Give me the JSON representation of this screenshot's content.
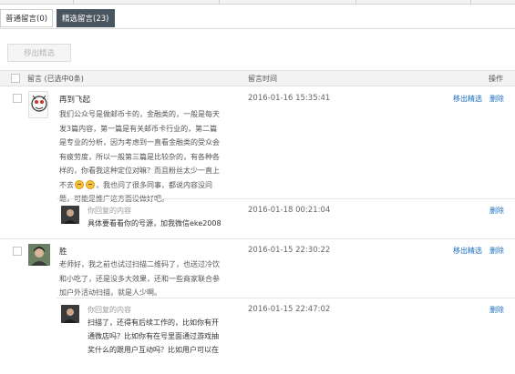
{
  "tabs": [
    {
      "label": "普通留言(0)"
    },
    {
      "label": "精选留言(23)"
    }
  ],
  "toolbar": {
    "move_label": "移出精选"
  },
  "table_header": {
    "message": "留言 (已选中0条)",
    "time": "留言时间",
    "action": "操作"
  },
  "comments": [
    {
      "nickname": "再到飞起",
      "lines": [
        "我们公众号是做邮币卡的，金融类的，一般是每天",
        "发3篇内容，第一篇是有关邮币卡行业的，第二篇",
        "是专业的分析，因为考虑到一直看金融类的受众会",
        "有疲劳度，所以一般第三篇是比较杂的，有各种各",
        "样的，你看我这种定位对嘛？而且粉丝太少一直上",
        "不去",
        "，我也问了很多同事，都说内容没问",
        "题，可能是推广这方面没做好吧。"
      ],
      "time": "2016-01-16 15:35:41",
      "action_primary": "移出精选",
      "action_delete": "删除",
      "reply": {
        "label": "你回复的内容",
        "lines": [
          "具体要看看你的号源，加我微信eke2008"
        ],
        "time": "2016-01-18 00:21:04",
        "action_delete": "删除"
      }
    },
    {
      "nickname": "胜",
      "lines": [
        "老师好，我之前也试过扫描二维码了，也送过冷饮",
        "和小吃了，还是没多大效果，还和一些商家联合参",
        "加户外活动扫描，就是人少啊。"
      ],
      "time": "2016-01-15 22:30:22",
      "action_primary": "移出精选",
      "action_delete": "删除",
      "reply": {
        "label": "你回复的内容",
        "lines": [
          "扫描了，还得有后续工作的，比如你有开",
          "通微店吗？比如你有在号里面通过游戏抽",
          "奖什么的跟用户互动吗？比如用户可以在"
        ],
        "time": "2016-01-15 22:47:02",
        "action_delete": "删除"
      }
    }
  ],
  "colors": {
    "active_tab_bg": "#4a5562",
    "link": "#1c6fbf",
    "header_bg": "#f3f3f3"
  },
  "icons": [
    "checkbox-icon",
    "emoji-icon"
  ]
}
